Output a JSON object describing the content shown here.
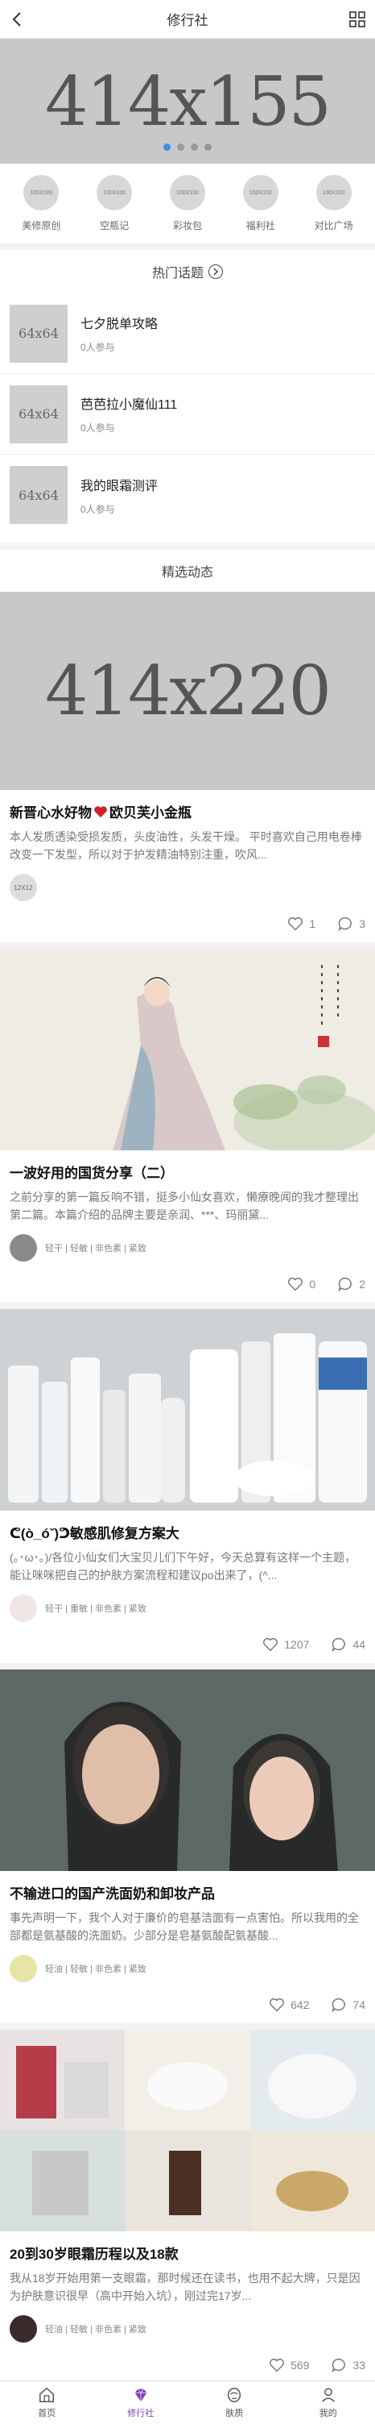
{
  "header": {
    "title": "修行社"
  },
  "banner": {
    "placeholder": "414x155",
    "active_dot": 0,
    "dot_count": 4
  },
  "quick_nav": [
    {
      "icon_text": "100X100",
      "label": "美修原创"
    },
    {
      "icon_text": "100X100",
      "label": "空瓶记"
    },
    {
      "icon_text": "100X100",
      "label": "彩妆包"
    },
    {
      "icon_text": "100X100",
      "label": "福利社"
    },
    {
      "icon_text": "100X100",
      "label": "对比广场"
    }
  ],
  "hot_topics": {
    "title": "热门话题",
    "items": [
      {
        "thumb": "64x64",
        "name": "七夕脱单攻略",
        "count": "0人参与"
      },
      {
        "thumb": "64x64",
        "name": "芭芭拉小魔仙111",
        "count": "0人参与"
      },
      {
        "thumb": "64x64",
        "name": "我的眼霜测评",
        "count": "0人参与"
      }
    ]
  },
  "feed": {
    "title": "精选动态",
    "posts": [
      {
        "image_placeholder": "414x220",
        "title": "新晋心水好物",
        "title_suffix": "欧贝芙小金瓶",
        "desc": "本人发质透染受损发质，头皮油性，头发干燥。 平时喜欢自己用电卷棒改变一下发型，所以对于护发精油特别注重，吹风...",
        "avatar_text": "12X12",
        "tags": "",
        "likes": "1",
        "comments": "3"
      },
      {
        "title": "一波好用的国货分享（二）",
        "desc": "之前分享的第一篇反响不错，挺多小仙女喜欢，懒療晚闻的我才整理出第二篇。本篇介绍的品牌主要是亲润、***、玛丽黛...",
        "tags": "轻干 | 轻敏 | 非色素 | 紧致",
        "likes": "0",
        "comments": "2"
      },
      {
        "title": "ᕦ(ò_óˇ)ᕤ敏感肌修复方案大",
        "desc": "(｡･ω･｡)/各位小仙女们大宝贝儿们下午好，今天总算有这样一个主题，能让咪咪把自己的护肤方案流程和建议po出来了，(^...",
        "tags": "轻干 | 重敏 | 非色素 | 紧致",
        "likes": "1207",
        "comments": "44"
      },
      {
        "title": "不输进口的国产洗面奶和卸妆产品",
        "desc": "事先声明一下，我个人对于廉价的皂基洁面有一点害怕。所以我用的全部都是氨基酸的洗面奶。少部分是皂基氨酸配氨基酸...",
        "tags": "轻油 | 轻敏 | 非色素 | 紧致",
        "likes": "642",
        "comments": "74"
      },
      {
        "title": "20到30岁眼霜历程以及18款",
        "desc": "我从18岁开始用第一支眼霜，那时候还在读书，也用不起大牌，只是因为护肤意识很早（高中开始入坑），刚过完17岁...",
        "tags": "轻油 | 轻敏 | 非色素 | 紧致",
        "likes": "569",
        "comments": "33"
      }
    ]
  },
  "tabbar": [
    {
      "label": "首页",
      "icon": "home-icon"
    },
    {
      "label": "修行社",
      "icon": "diamond-icon",
      "active": true
    },
    {
      "label": "肤质",
      "icon": "face-icon"
    },
    {
      "label": "我的",
      "icon": "user-icon"
    }
  ]
}
